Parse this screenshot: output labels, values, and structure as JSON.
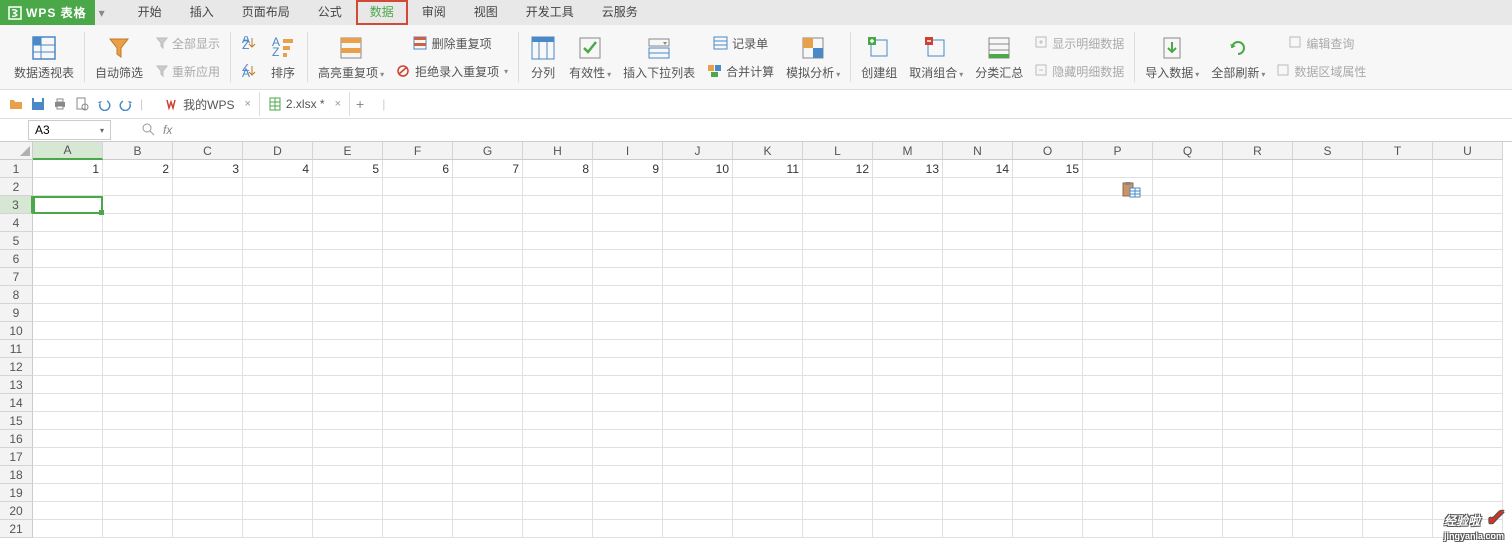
{
  "app": {
    "name": "WPS 表格"
  },
  "menu": {
    "start": "开始",
    "insert": "插入",
    "layout": "页面布局",
    "formula": "公式",
    "data": "数据",
    "review": "审阅",
    "view": "视图",
    "dev": "开发工具",
    "cloud": "云服务"
  },
  "ribbon": {
    "pivot": "数据透视表",
    "autofilter": "自动筛选",
    "showall": "全部显示",
    "reapply": "重新应用",
    "sort": "排序",
    "highlight": "高亮重复项",
    "removedup": "删除重复项",
    "reject": "拒绝录入重复项",
    "split": "分列",
    "validity": "有效性",
    "droplist": "插入下拉列表",
    "record": "记录单",
    "consol": "合并计算",
    "whatif": "模拟分析",
    "group": "创建组",
    "ungroup": "取消组合",
    "subtotal": "分类汇总",
    "showdetail": "显示明细数据",
    "hidedetail": "隐藏明细数据",
    "import": "导入数据",
    "refreshall": "全部刷新",
    "editquery": "编辑查询",
    "rangeprops": "数据区域属性"
  },
  "tabs": {
    "mywps": "我的WPS",
    "file": "2.xlsx *"
  },
  "cellref": "A3",
  "fx": "fx",
  "cols": [
    "A",
    "B",
    "C",
    "D",
    "E",
    "F",
    "G",
    "H",
    "I",
    "J",
    "K",
    "L",
    "M",
    "N",
    "O",
    "P",
    "Q",
    "R",
    "S",
    "T",
    "U"
  ],
  "rows": [
    "1",
    "2",
    "3",
    "4",
    "5",
    "6",
    "7",
    "8",
    "9",
    "10",
    "11",
    "12",
    "13",
    "14",
    "15",
    "16",
    "17",
    "18",
    "19",
    "20",
    "21"
  ],
  "data_row1": [
    "1",
    "2",
    "3",
    "4",
    "5",
    "6",
    "7",
    "8",
    "9",
    "10",
    "11",
    "12",
    "13",
    "14",
    "15"
  ],
  "watermark": {
    "text": "经验啦",
    "url": "jingyanla.com"
  }
}
